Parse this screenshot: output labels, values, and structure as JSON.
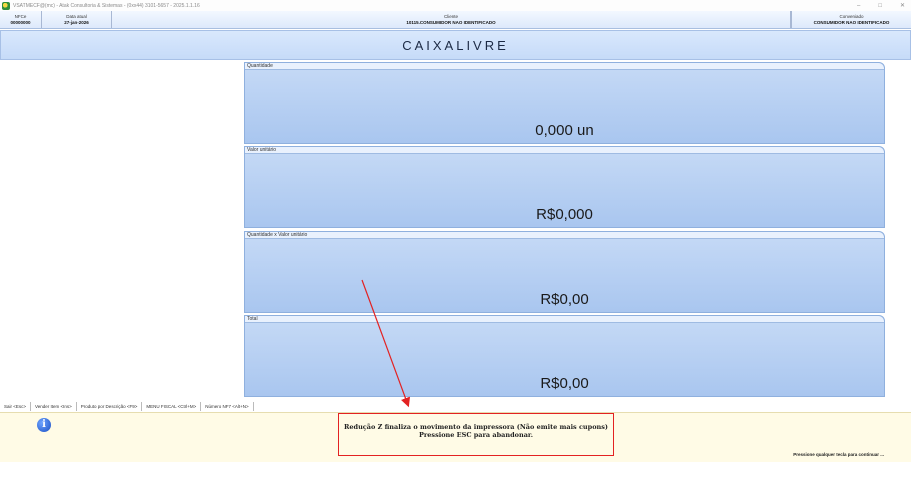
{
  "window": {
    "title": "VSATMECF@(mc) - Atak Consultoria & Sistemas - (0xx44) 3101-5657 - 2025.1.1.16",
    "controls": [
      "–",
      "□",
      "✕"
    ]
  },
  "header": {
    "nfce_label": "NFCe",
    "nfce_value": "00000000",
    "date_label": "Data atual",
    "date_value": "27-jan-2026",
    "client_label": "Cliente",
    "client_value": "10115.CONSUMIDOR NAO IDENTIFICADO",
    "conv_label": "Conveniado",
    "conv_value": "CONSUMIDOR NAO IDENTIFICADO"
  },
  "status": "CAIXALIVRE",
  "panels": [
    {
      "label": "Quantidade",
      "value": "0,000 un"
    },
    {
      "label": "Valor unitário",
      "value": "R$0,000"
    },
    {
      "label": "Quantidade x Valor unitário",
      "value": "R$0,00"
    },
    {
      "label": "Total",
      "value": "R$0,00"
    }
  ],
  "shortcuts": [
    "Sair <Esc>",
    "Vender Item <Ins>",
    "Produto por Descrição <F9>",
    "MENU FISCAL <Ctrl+M>",
    "Número NF7 <Alt+N>"
  ],
  "message": {
    "line1": "Redução Z finaliza o movimento da impressora (Não emite mais cupons)",
    "line2": "Pressione ESC para abandonar.",
    "continue": "Pressione qualquer tecla para continuar ..."
  },
  "colors": {
    "panel": "#b8d0f3",
    "message_border": "#e32222",
    "message_bg": "#fffbe6"
  }
}
